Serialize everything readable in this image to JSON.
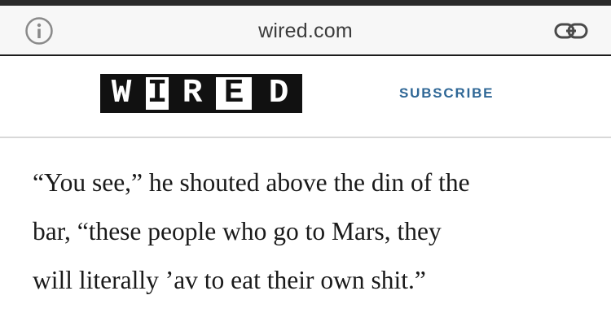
{
  "browser": {
    "url": "wired.com",
    "icons": {
      "left": "info-icon",
      "right": "link-icon"
    }
  },
  "header": {
    "logo_letters": [
      "W",
      "I",
      "R",
      "E",
      "D"
    ],
    "subscribe_label": "SUBSCRIBE"
  },
  "article": {
    "lines": [
      "“You see,” he shouted above the din of the",
      "bar, “these people who go to Mars, they",
      "will literally ’av to eat their own shit.”"
    ]
  },
  "colors": {
    "subscribe": "#2f6796",
    "logo": "#111111"
  }
}
